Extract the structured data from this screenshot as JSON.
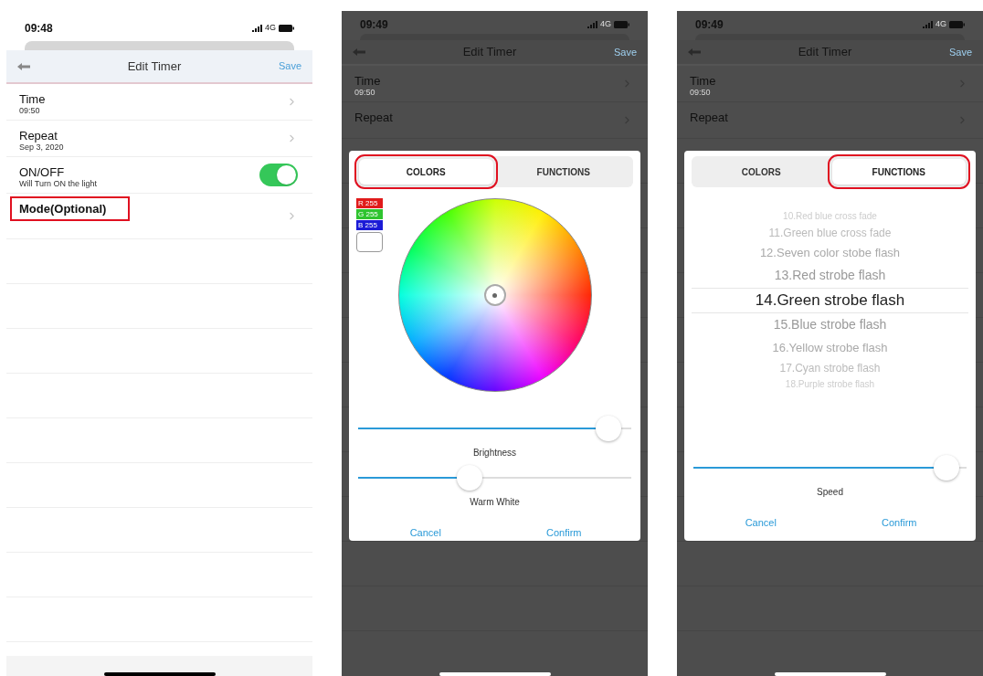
{
  "screens": [
    {
      "dimmed": false,
      "status": {
        "time": "09:48",
        "network": "4G"
      },
      "nav": {
        "title": "Edit Timer",
        "save": "Save"
      },
      "rows": [
        {
          "kind": "chevron",
          "title": "Time",
          "subtitle": "09:50",
          "bold": false,
          "highlighted": false
        },
        {
          "kind": "chevron",
          "title": "Repeat",
          "subtitle": "Sep 3, 2020",
          "bold": false,
          "highlighted": false
        },
        {
          "kind": "switch",
          "title": "ON/OFF",
          "subtitle": "Will Turn ON the light",
          "on": true,
          "bold": false,
          "highlighted": false
        },
        {
          "kind": "chevron",
          "title": "Mode(Optional)",
          "bold": true,
          "highlighted": true
        }
      ]
    },
    {
      "dimmed": true,
      "status": {
        "time": "09:49",
        "network": "4G"
      },
      "nav": {
        "title": "Edit Timer",
        "save": "Save"
      },
      "rows": [
        {
          "kind": "chevron",
          "title": "Time",
          "subtitle": "09:50",
          "bold": false,
          "highlighted": false
        },
        {
          "kind": "chevron",
          "title": "Repeat",
          "bold": false,
          "highlighted": false
        }
      ],
      "modal": {
        "kind": "colors",
        "tabs": [
          {
            "label": "COLORS",
            "selected": true,
            "highlighted": true
          },
          {
            "label": "FUNCTIONS",
            "selected": false,
            "highlighted": false
          }
        ],
        "rgb": [
          {
            "label": "R 255",
            "color": "#e01b1b"
          },
          {
            "label": "G 255",
            "color": "#2fc42f"
          },
          {
            "label": "B 255",
            "color": "#1b1bd6"
          }
        ],
        "sliders": [
          {
            "label": "Brightness",
            "level": 0.96
          },
          {
            "label": "Warm White",
            "level": 0.4
          }
        ],
        "buttons": [
          "Cancel",
          "Confirm"
        ]
      }
    },
    {
      "dimmed": true,
      "status": {
        "time": "09:49",
        "network": "4G"
      },
      "nav": {
        "title": "Edit Timer",
        "save": "Save"
      },
      "rows": [
        {
          "kind": "chevron",
          "title": "Time",
          "subtitle": "09:50",
          "bold": false,
          "highlighted": false
        },
        {
          "kind": "chevron",
          "title": "Repeat",
          "bold": false,
          "highlighted": false
        }
      ],
      "modal": {
        "kind": "functions",
        "tabs": [
          {
            "label": "COLORS",
            "selected": false,
            "highlighted": false
          },
          {
            "label": "FUNCTIONS",
            "selected": true,
            "highlighted": true
          }
        ],
        "modes": [
          {
            "label": "10.Red blue cross fade",
            "selected": false
          },
          {
            "label": "11.Green blue cross fade",
            "selected": false
          },
          {
            "label": "12.Seven color stobe flash",
            "selected": false
          },
          {
            "label": "13.Red strobe flash",
            "selected": false
          },
          {
            "label": "14.Green strobe flash",
            "selected": true
          },
          {
            "label": "15.Blue strobe flash",
            "selected": false
          },
          {
            "label": "16.Yellow strobe flash",
            "selected": false
          },
          {
            "label": "17.Cyan strobe flash",
            "selected": false
          },
          {
            "label": "18.Purple strobe flash",
            "selected": false
          }
        ],
        "sliders": [
          {
            "label": "Speed",
            "level": 0.97
          }
        ],
        "buttons": [
          "Cancel",
          "Confirm"
        ]
      }
    }
  ]
}
